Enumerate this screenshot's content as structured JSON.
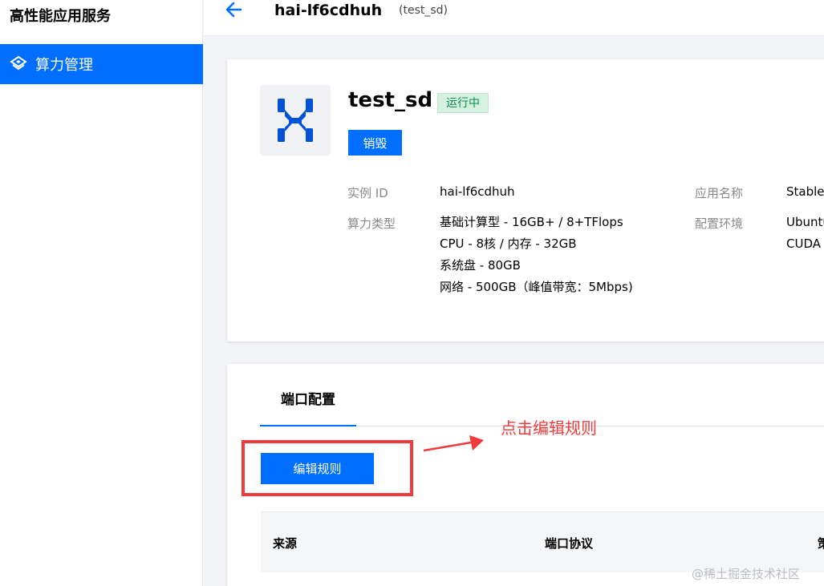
{
  "sidebar": {
    "title": "高性能应用服务",
    "items": [
      {
        "label": "算力管理"
      }
    ]
  },
  "header": {
    "title": "hai-lf6cdhuh",
    "subtitle": "(test_sd)"
  },
  "instance": {
    "name": "test_sd",
    "status": "运行中",
    "destroy_label": "销毁",
    "labels": {
      "id": "实例 ID",
      "type": "算力类型",
      "app": "应用名称",
      "env": "配置环境"
    },
    "values": {
      "id": "hai-lf6cdhuh",
      "type_lines": [
        "基础计算型 - 16GB+ / 8+TFlops",
        "CPU - 8核 / 内存 - 32GB",
        "系统盘 - 80GB",
        "网络 - 500GB（峰值带宽：5Mbps)"
      ],
      "app": "Stable",
      "env_lines": [
        "Ubuntu",
        "CUDA"
      ]
    }
  },
  "ports": {
    "tab_label": "端口配置",
    "edit_label": "编辑规则",
    "columns": [
      "来源",
      "端口协议",
      "策"
    ]
  },
  "annotation": {
    "text": "点击编辑规则",
    "color": "#f03b3b"
  },
  "watermark": "@稀土掘金技术社区",
  "colors": {
    "accent": "#006eff",
    "status_bg": "#d5f1e1",
    "status_text": "#0e8a47"
  }
}
